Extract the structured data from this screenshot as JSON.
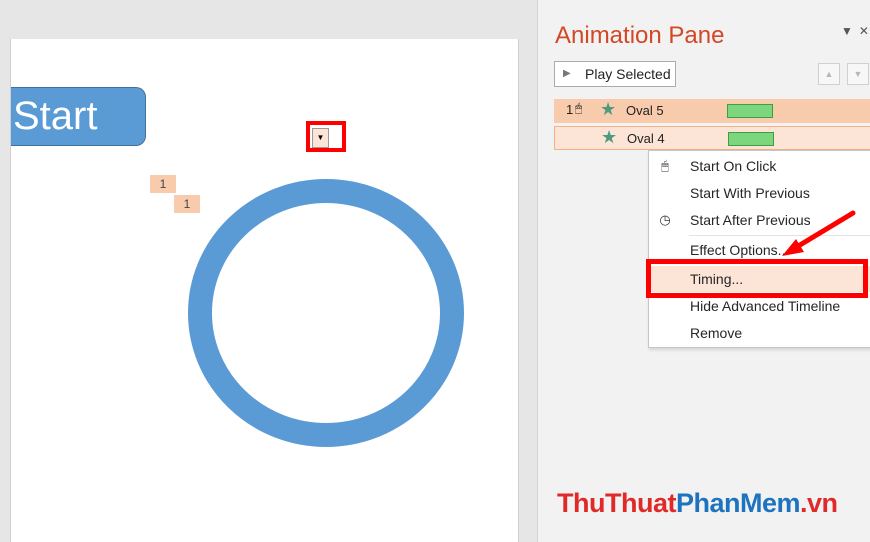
{
  "slide": {
    "start_button_label": "Start",
    "animation_tags": [
      "1",
      "1"
    ],
    "ring_color": "#5b9bd5"
  },
  "animation_pane": {
    "title": "Animation Pane",
    "title_color": "#d24726",
    "play_selected_label": "Play Selected",
    "items": [
      {
        "index": "1",
        "trigger_icon": "mouse-click-icon",
        "effect_icon": "star-icon",
        "name": "Oval 5"
      },
      {
        "index": "",
        "trigger_icon": "",
        "effect_icon": "star-icon",
        "name": "Oval 4"
      }
    ]
  },
  "context_menu": {
    "items": [
      {
        "icon": "mouse-click-icon",
        "label": "Start On Click"
      },
      {
        "icon": "",
        "label": "Start With Previous"
      },
      {
        "icon": "clock-icon",
        "label": "Start After Previous"
      },
      {
        "icon": "",
        "label": "Effect Options..."
      },
      {
        "icon": "",
        "label": "Timing..."
      },
      {
        "icon": "",
        "label": "Hide Advanced Timeline"
      },
      {
        "icon": "",
        "label": "Remove"
      }
    ],
    "highlighted_item": "Timing..."
  },
  "annotation_color": "#ff0000",
  "watermark": {
    "part1": "ThuThuat",
    "part2": "PhanMem",
    "part3": ".vn"
  }
}
